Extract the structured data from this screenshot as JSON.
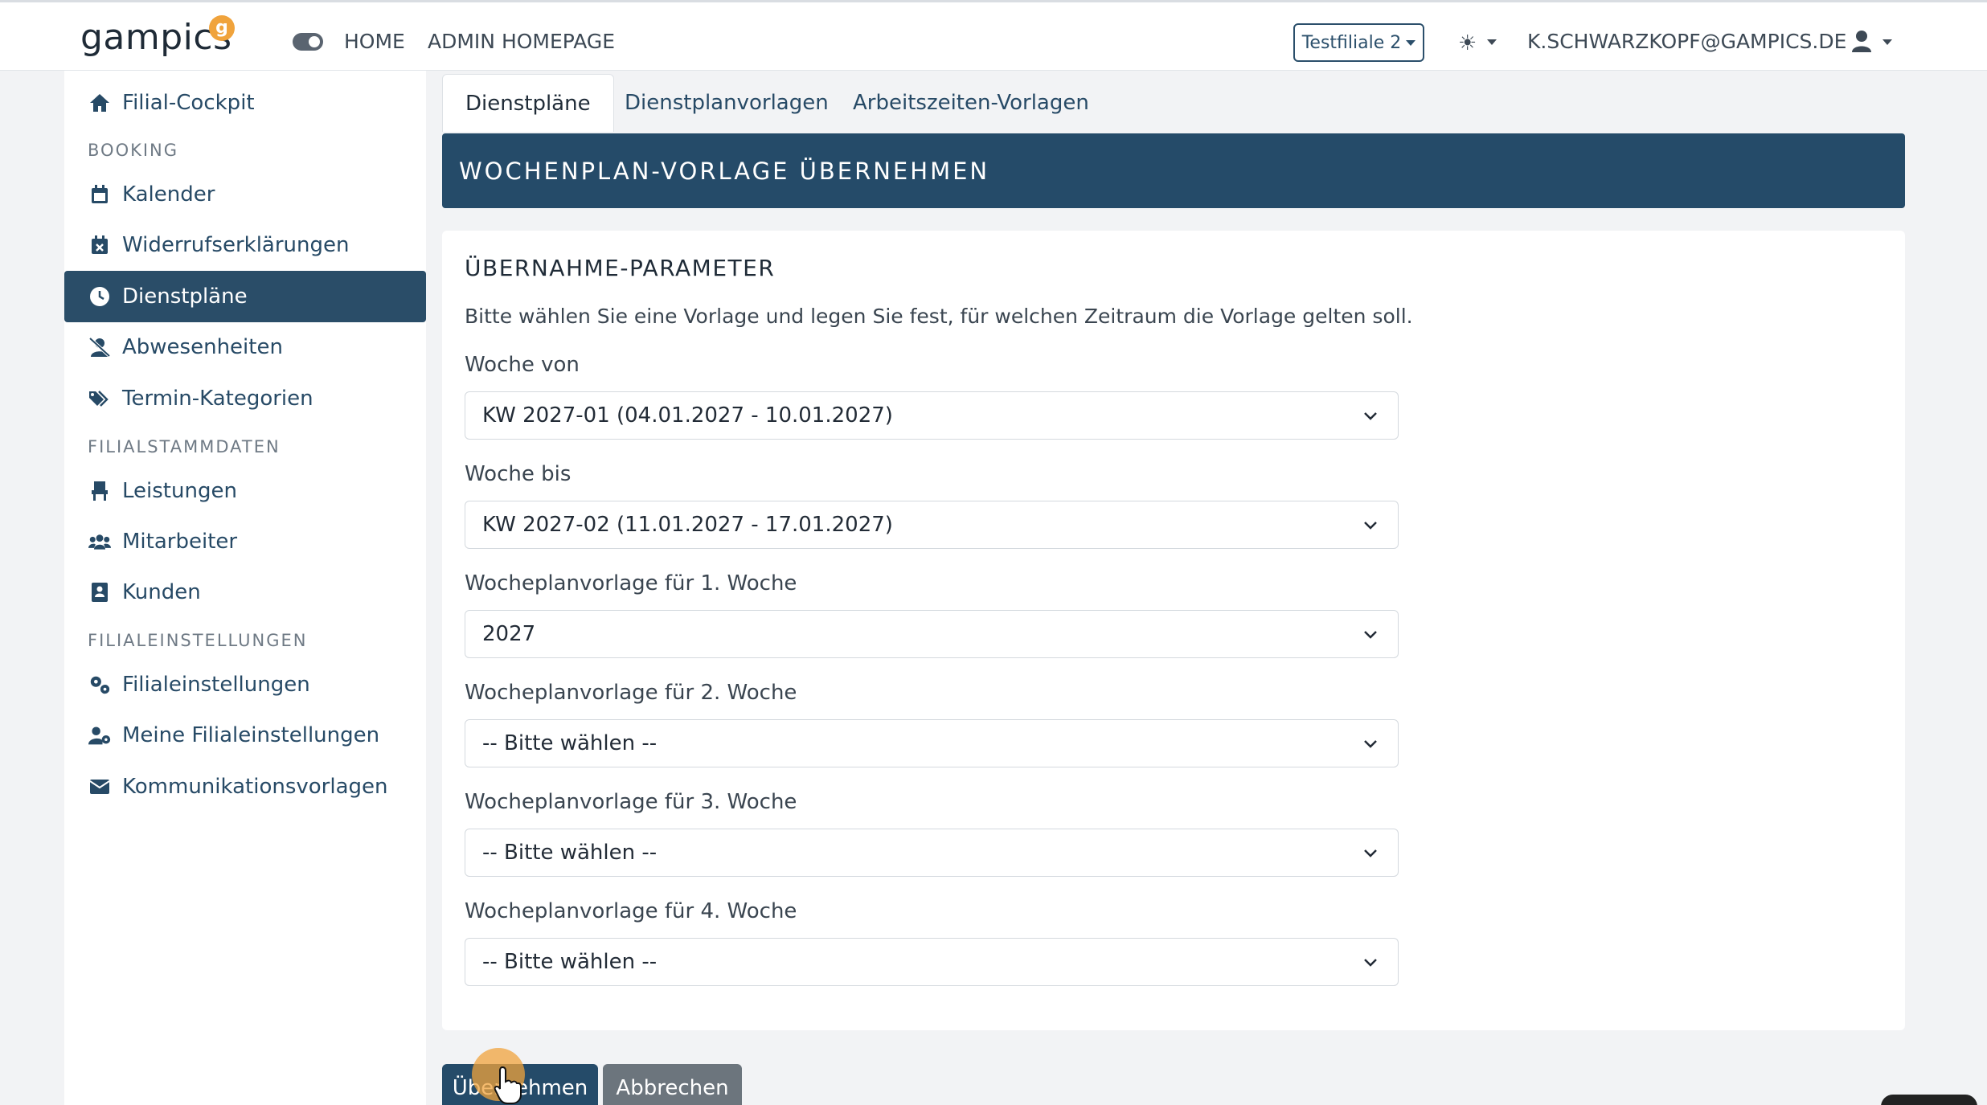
{
  "header": {
    "logo_text": "gampics",
    "logo_badge": "g",
    "nav": [
      "HOME",
      "ADMIN HOMEPAGE"
    ],
    "filiale_button": "Testfiliale 2",
    "user_email": "K.SCHWARZKOPF@GAMPICS.DE"
  },
  "sidebar": {
    "items": [
      {
        "label": "Filial-Cockpit",
        "icon": "home-icon"
      },
      {
        "section": "BOOKING"
      },
      {
        "label": "Kalender",
        "icon": "calendar-icon"
      },
      {
        "label": "Widerrufserklärungen",
        "icon": "calendar-x-icon"
      },
      {
        "label": "Dienstpläne",
        "icon": "clock-icon",
        "active": true
      },
      {
        "label": "Abwesenheiten",
        "icon": "user-slash-icon"
      },
      {
        "label": "Termin-Kategorien",
        "icon": "tags-icon"
      },
      {
        "section": "FILIALSTAMMDATEN"
      },
      {
        "label": "Leistungen",
        "icon": "chair-icon"
      },
      {
        "label": "Mitarbeiter",
        "icon": "users-icon"
      },
      {
        "label": "Kunden",
        "icon": "address-book-icon"
      },
      {
        "section": "FILIALEINSTELLUNGEN"
      },
      {
        "label": "Filialeinstellungen",
        "icon": "cogs-icon"
      },
      {
        "label": "Meine Filialeinstellungen",
        "icon": "user-cog-icon"
      },
      {
        "label": "Kommunikationsvorlagen",
        "icon": "envelope-icon"
      }
    ]
  },
  "tabs": [
    "Dienstpläne",
    "Dienstplanvorlagen",
    "Arbeitszeiten-Vorlagen"
  ],
  "banner_title": "WOCHENPLAN-VORLAGE ÜBERNEHMEN",
  "card": {
    "title": "ÜBERNAHME-PARAMETER",
    "description": "Bitte wählen Sie eine Vorlage und legen Sie fest, für welchen Zeitraum die Vorlage gelten soll.",
    "fields": [
      {
        "label": "Woche von",
        "value": "KW 2027-01 (04.01.2027 - 10.01.2027)"
      },
      {
        "label": "Woche bis",
        "value": "KW 2027-02 (11.01.2027 - 17.01.2027)"
      },
      {
        "label": "Wocheplanvorlage für 1. Woche",
        "value": "2027"
      },
      {
        "label": "Wocheplanvorlage für 2. Woche",
        "value": "-- Bitte wählen --"
      },
      {
        "label": "Wocheplanvorlage für 3. Woche",
        "value": "-- Bitte wählen --"
      },
      {
        "label": "Wocheplanvorlage für 4. Woche",
        "value": "-- Bitte wählen --"
      }
    ]
  },
  "buttons": {
    "submit": "Übernehmen",
    "cancel": "Abbrechen"
  },
  "colors": {
    "primary": "#254b69",
    "accent": "#f0a33c",
    "secondary": "#6c757d"
  }
}
